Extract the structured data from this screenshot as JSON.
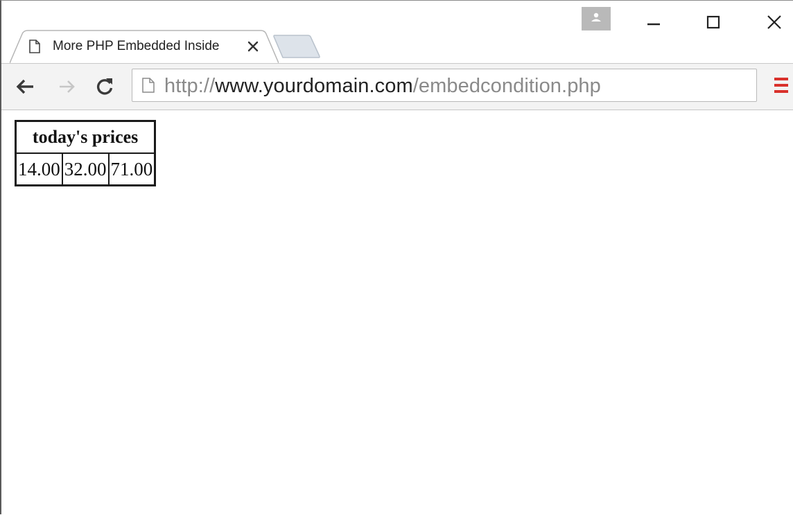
{
  "browser": {
    "tab": {
      "title": "More PHP Embedded Inside",
      "icon": "page-icon",
      "close_icon": "close-icon"
    },
    "window_controls": [
      "minimize-icon",
      "maximize-icon",
      "close-icon"
    ],
    "profile_icon": "person-icon",
    "toolbar": {
      "back_icon": "back-arrow-icon",
      "forward_icon": "forward-arrow-icon",
      "reload_icon": "reload-icon",
      "menu_icon": "hamburger-menu-icon",
      "menu_icon_color": "#d9312b"
    },
    "address_bar": {
      "scheme": "http://",
      "host": "www.yourdomain.com",
      "path": "/embedcondition.php"
    }
  },
  "page": {
    "table": {
      "header": "today's prices",
      "cells": [
        "14.00",
        "32.00",
        "71.00"
      ]
    }
  }
}
